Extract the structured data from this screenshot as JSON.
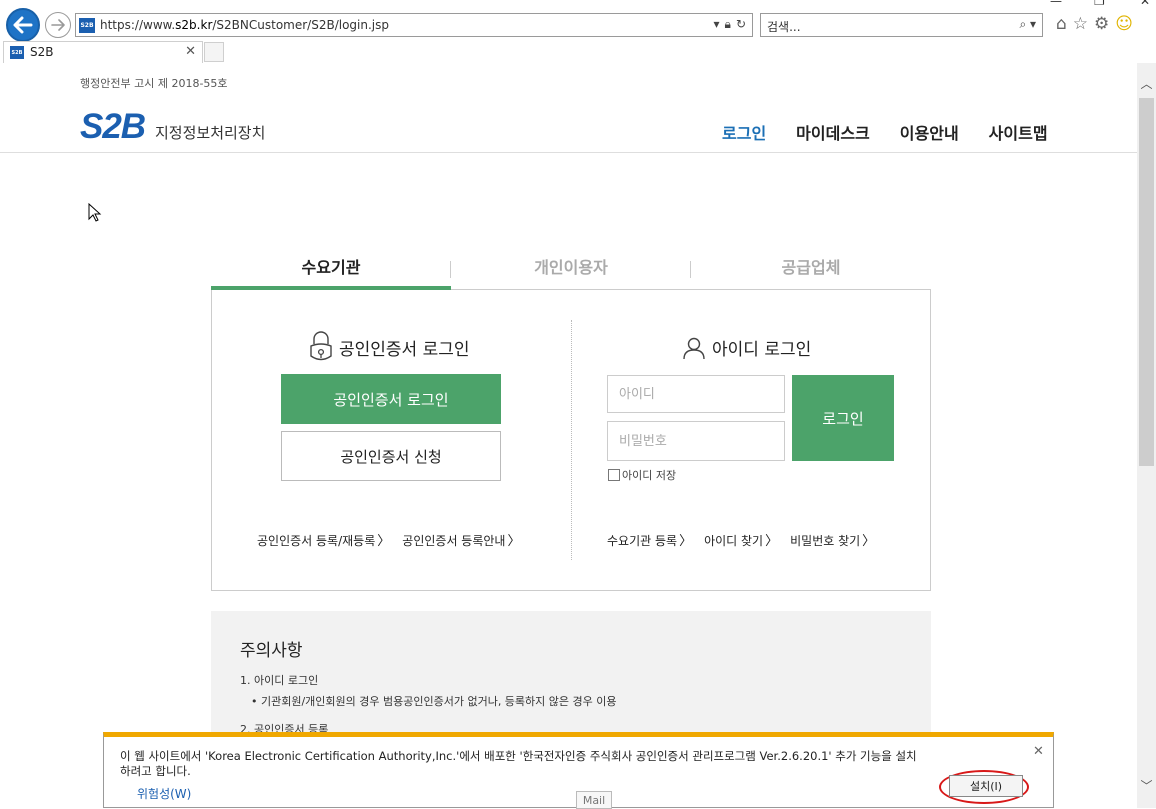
{
  "browser": {
    "url_prefix": "https://www.",
    "url_host": "s2b.kr",
    "url_path": "/S2BNCustomer/S2B/login.jsp",
    "search_placeholder": "검색...",
    "tab_title": "S2B",
    "favicon_text": "S2B"
  },
  "header": {
    "notice": "행정안전부 고시 제 2018-55호",
    "logo": "S2B",
    "logo_sub": "지정정보처리장치",
    "nav": [
      "로그인",
      "마이데스크",
      "이용안내",
      "사이트맵"
    ]
  },
  "user_tabs": [
    "수요기관",
    "개인이용자",
    "공급업체"
  ],
  "cert": {
    "title": "공인인증서 로그인",
    "login_button": "공인인증서 로그인",
    "apply_button": "공인인증서 신청",
    "links": [
      "공인인증서 등록/재등록",
      "공인인증서 등록안내"
    ]
  },
  "id_login": {
    "title": "아이디 로그인",
    "id_placeholder": "아이디",
    "pw_placeholder": "비밀번호",
    "login_button": "로그인",
    "save_id_label": "아이디 저장",
    "links": [
      "수요기관 등록",
      "아이디 찾기",
      "비밀번호 찾기"
    ]
  },
  "caution": {
    "title": "주의사항",
    "item1": "1. 아이디 로그인",
    "item1_detail": "• 기관회원/개인회원의 경우 범용공인인증서가 없거나, 등록하지 않은 경우 이용",
    "item2": "2. 공인인증서 등록"
  },
  "notification": {
    "message": "이 웹 사이트에서 'Korea Electronic Certification Authority,Inc.'에서 배포한 '한국전자인증 주식회사 공인인증서 관리프로그램 Ver.2.6.20.1' 추가 기능을 설치하려고 합니다.",
    "risk_link": "위험성(W)",
    "install_button": "설치(I)",
    "tooltip": "Mail"
  },
  "colors": {
    "brand_blue": "#1b5fb0",
    "accent_green": "#4ca36a",
    "notification_bar": "#f0a800",
    "highlight_ring": "#d81818"
  }
}
